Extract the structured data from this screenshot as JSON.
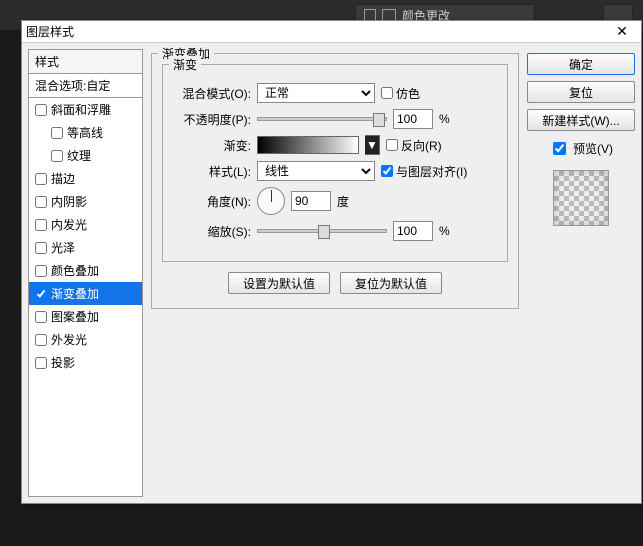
{
  "bg": {
    "panel_label": "颜色更改"
  },
  "dialog": {
    "title": "图层样式",
    "close": "✕",
    "left": {
      "styles_header": "样式",
      "blend_header": "混合选项:自定",
      "items": [
        {
          "label": "斜面和浮雕",
          "checked": false,
          "sub": false
        },
        {
          "label": "等高线",
          "checked": false,
          "sub": true
        },
        {
          "label": "纹理",
          "checked": false,
          "sub": true
        },
        {
          "label": "描边",
          "checked": false,
          "sub": false
        },
        {
          "label": "内阴影",
          "checked": false,
          "sub": false
        },
        {
          "label": "内发光",
          "checked": false,
          "sub": false
        },
        {
          "label": "光泽",
          "checked": false,
          "sub": false
        },
        {
          "label": "颜色叠加",
          "checked": false,
          "sub": false
        },
        {
          "label": "渐变叠加",
          "checked": true,
          "sub": false,
          "selected": true
        },
        {
          "label": "图案叠加",
          "checked": false,
          "sub": false
        },
        {
          "label": "外发光",
          "checked": false,
          "sub": false
        },
        {
          "label": "投影",
          "checked": false,
          "sub": false
        }
      ]
    },
    "mid": {
      "group_title": "渐变叠加",
      "inner_title": "渐变",
      "blend_mode_label": "混合模式(O):",
      "blend_mode_value": "正常",
      "dither_label": "仿色",
      "opacity_label": "不透明度(P):",
      "opacity_value": "100",
      "opacity_unit": "%",
      "gradient_label": "渐变:",
      "reverse_label": "反向(R)",
      "style_label": "样式(L):",
      "style_value": "线性",
      "align_label": "与图层对齐(I)",
      "angle_label": "角度(N):",
      "angle_value": "90",
      "angle_unit": "度",
      "scale_label": "缩放(S):",
      "scale_value": "100",
      "scale_unit": "%",
      "make_default": "设置为默认值",
      "reset_default": "复位为默认值"
    },
    "right": {
      "ok": "确定",
      "reset": "复位",
      "new_style": "新建样式(W)...",
      "preview_label": "预览(V)"
    }
  }
}
